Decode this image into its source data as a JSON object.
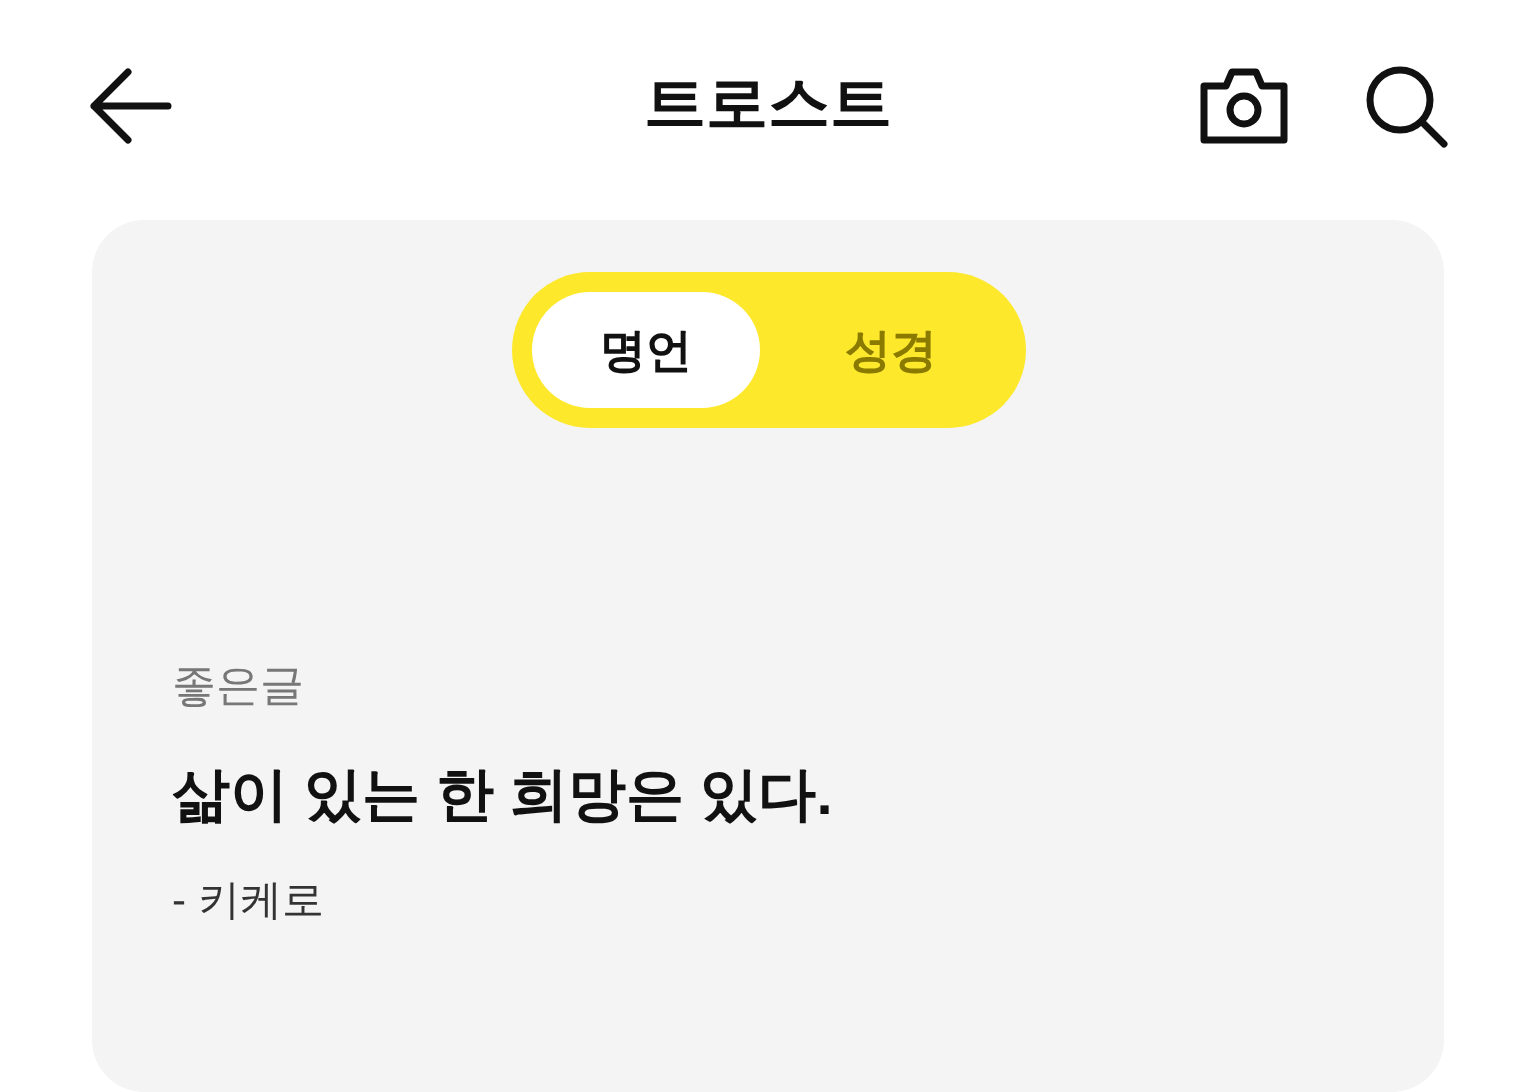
{
  "header": {
    "title": "트로스트"
  },
  "tabs": [
    {
      "label": "명언",
      "selected": true
    },
    {
      "label": "성경",
      "selected": false
    }
  ],
  "quote": {
    "category": "좋은글",
    "text": "삶이 있는 한 희망은 있다.",
    "author": "- 키케로"
  }
}
